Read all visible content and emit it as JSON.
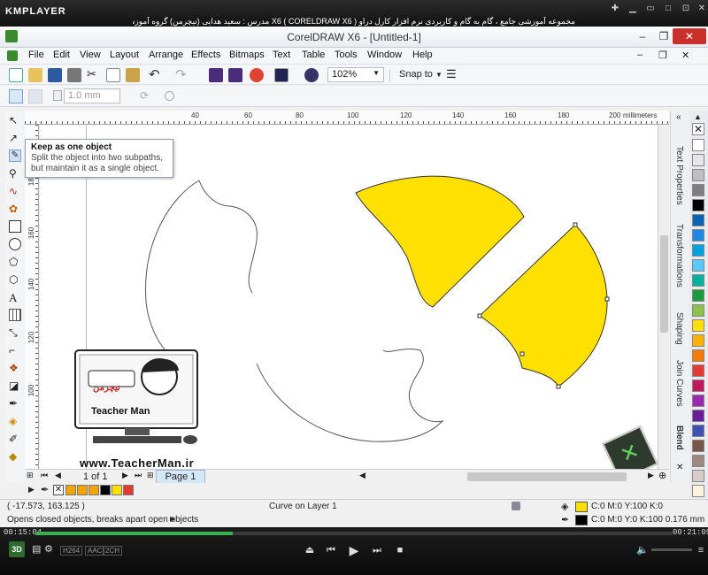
{
  "player": {
    "logo": "KMPLAYER",
    "title": "مجموعه آموزشی جامع ، گام به گام و کاربردی نرم افزار کارل دراو X6 ( CORELDRAW X6 )   مدرس : سعید هدایی (تیچرمن) گروه آموزشی پادشاه گرافیست ها",
    "time_elapsed": "00:15:04",
    "time_total": "00:21:09",
    "progress": 0.31,
    "badge": "3D",
    "codec_labels": [
      "H264",
      "AAC",
      "2CH"
    ]
  },
  "window": {
    "title": "CorelDRAW X6 - [Untitled-1]"
  },
  "menu": [
    "File",
    "Edit",
    "View",
    "Layout",
    "Arrange",
    "Effects",
    "Bitmaps",
    "Text",
    "Table",
    "Tools",
    "Window",
    "Help"
  ],
  "toolbar": {
    "zoom": "102%",
    "snap_to": "Snap to"
  },
  "propbar": {
    "width_value": "1.0 mm"
  },
  "tooltip": {
    "title": "Keep as one object",
    "text": "Split the object into two subpaths, but maintain it as a single object."
  },
  "ruler": {
    "units": "millimeters",
    "h_ticks": [
      "40",
      "60",
      "80",
      "100",
      "120",
      "140",
      "160",
      "180",
      "200"
    ],
    "v_ticks": [
      "180",
      "160",
      "140",
      "120",
      "100"
    ]
  },
  "dockers": [
    "Text Properties",
    "Transformations",
    "Shaping",
    "Join Curves",
    "Blend"
  ],
  "page_nav": {
    "page_of": "1 of 1",
    "page_tab": "Page 1"
  },
  "status": {
    "coords": "( -17.573, 163.125 )",
    "layer": "Curve on Layer 1",
    "hint": "Opens closed objects, breaks apart open objects",
    "fill_info": "C:0 M:0 Y:100 K:0",
    "outline_info": "C:0 M:0 Y:0 K:100  0.176 mm"
  },
  "watermark": {
    "url": "www.TeacherMan.ir",
    "brand": "Teacher Man",
    "brand_fa": "تیچرمن"
  },
  "colors": {
    "fill_yellow": "#ffe000",
    "outline": "#000000",
    "palette": [
      "#ffffff",
      "#e6e6e6",
      "#bfbfbf",
      "#7f7f7f",
      "#000000",
      "#0b63b5",
      "#1e88e5",
      "#00a3e0",
      "#5ac8fa",
      "#00b4a0",
      "#1a9b3c",
      "#8bc34a",
      "#ffe000",
      "#ffb300",
      "#f57c00",
      "#e53935",
      "#c2185b",
      "#9c27b0",
      "#6a1b9a",
      "#3f51b5",
      "#795548",
      "#a1887f",
      "#d7ccc8",
      "#fff3e0"
    ],
    "doc_palette": [
      "#f2a400",
      "#f2a400",
      "#f2a400",
      "#000000",
      "#ffe000",
      "#e53935"
    ]
  }
}
